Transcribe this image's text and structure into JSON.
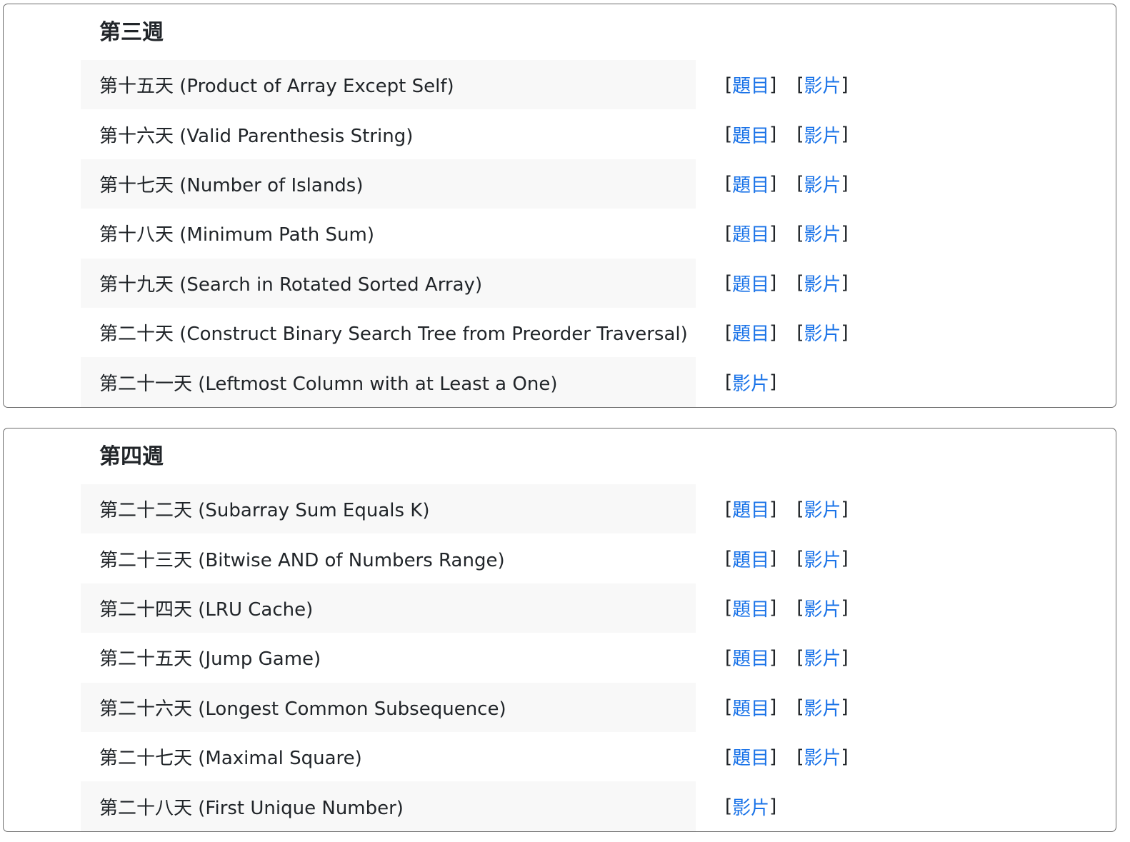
{
  "weeks": [
    {
      "title": "第三週",
      "days": [
        {
          "label": "第十五天 (Product of Array Except Self)",
          "problem": "題目",
          "video": "影片"
        },
        {
          "label": "第十六天 (Valid Parenthesis String)",
          "problem": "題目",
          "video": "影片"
        },
        {
          "label": "第十七天 (Number of Islands)",
          "problem": "題目",
          "video": "影片"
        },
        {
          "label": "第十八天 (Minimum Path Sum)",
          "problem": "題目",
          "video": "影片"
        },
        {
          "label": "第十九天 (Search in Rotated Sorted Array)",
          "problem": "題目",
          "video": "影片"
        },
        {
          "label": "第二十天 (Construct Binary Search Tree from Preorder Traversal)",
          "problem": "題目",
          "video": "影片"
        },
        {
          "label": "第二十一天 (Leftmost Column with at Least a One)",
          "problem": null,
          "video": "影片"
        }
      ]
    },
    {
      "title": "第四週",
      "days": [
        {
          "label": "第二十二天 (Subarray Sum Equals K)",
          "problem": "題目",
          "video": "影片"
        },
        {
          "label": "第二十三天 (Bitwise AND of Numbers Range)",
          "problem": "題目",
          "video": "影片"
        },
        {
          "label": "第二十四天 (LRU Cache)",
          "problem": "題目",
          "video": "影片"
        },
        {
          "label": "第二十五天 (Jump Game)",
          "problem": "題目",
          "video": "影片"
        },
        {
          "label": "第二十六天 (Longest Common Subsequence)",
          "problem": "題目",
          "video": "影片"
        },
        {
          "label": "第二十七天 (Maximal Square)",
          "problem": "題目",
          "video": "影片"
        },
        {
          "label": "第二十八天 (First Unique Number)",
          "problem": null,
          "video": "影片"
        }
      ]
    }
  ],
  "brackets": {
    "open": "[",
    "close": "]"
  },
  "colors": {
    "link": "#1a73e8",
    "text": "#212529",
    "row_stripe": "#f8f8f8",
    "border": "#6c6c6c"
  }
}
